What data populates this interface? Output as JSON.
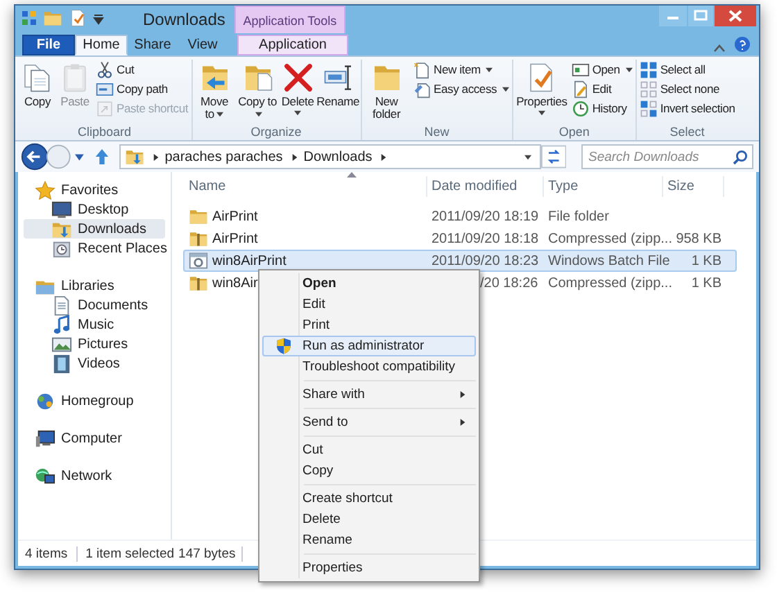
{
  "window": {
    "title": "Downloads",
    "contextual_group": "Application Tools"
  },
  "tabs": [
    {
      "label": "File",
      "kind": "file",
      "selected": false
    },
    {
      "label": "Home",
      "kind": "tab",
      "selected": true
    },
    {
      "label": "Share",
      "kind": "tab",
      "selected": false
    },
    {
      "label": "View",
      "kind": "tab",
      "selected": false
    },
    {
      "label": "Application",
      "kind": "contextual",
      "selected": false
    }
  ],
  "ribbon": [
    {
      "label": "Clipboard",
      "buttons": [
        {
          "label": "Copy",
          "kind": "large",
          "disabled": false,
          "dropdown": false
        },
        {
          "label": "Paste",
          "kind": "large",
          "disabled": true,
          "dropdown": false
        },
        {
          "label": "Cut",
          "kind": "small",
          "disabled": false,
          "dropdown": false
        },
        {
          "label": "Copy path",
          "kind": "small",
          "disabled": false,
          "dropdown": false
        },
        {
          "label": "Paste shortcut",
          "kind": "small",
          "disabled": true,
          "dropdown": false
        }
      ]
    },
    {
      "label": "Organize",
      "buttons": [
        {
          "label": "Move to",
          "kind": "large",
          "disabled": false,
          "dropdown": true
        },
        {
          "label": "Copy to",
          "kind": "large",
          "disabled": false,
          "dropdown": true
        },
        {
          "label": "Delete",
          "kind": "large",
          "disabled": false,
          "dropdown": true
        },
        {
          "label": "Rename",
          "kind": "large",
          "disabled": false,
          "dropdown": false
        }
      ]
    },
    {
      "label": "New",
      "buttons": [
        {
          "label": "New folder",
          "kind": "large",
          "disabled": false,
          "dropdown": false
        },
        {
          "label": "New item",
          "kind": "small",
          "disabled": false,
          "dropdown": true
        },
        {
          "label": "Easy access",
          "kind": "small",
          "disabled": false,
          "dropdown": true
        }
      ]
    },
    {
      "label": "Open",
      "buttons": [
        {
          "label": "Properties",
          "kind": "large",
          "disabled": false,
          "dropdown": true
        },
        {
          "label": "Open",
          "kind": "small",
          "disabled": false,
          "dropdown": true
        },
        {
          "label": "Edit",
          "kind": "small",
          "disabled": false,
          "dropdown": false
        },
        {
          "label": "History",
          "kind": "small",
          "disabled": false,
          "dropdown": false
        }
      ]
    },
    {
      "label": "Select",
      "buttons": [
        {
          "label": "Select all",
          "kind": "small",
          "disabled": false,
          "dropdown": false
        },
        {
          "label": "Select none",
          "kind": "small",
          "disabled": false,
          "dropdown": false
        },
        {
          "label": "Invert selection",
          "kind": "small",
          "disabled": false,
          "dropdown": false
        }
      ]
    }
  ],
  "address_bar": {
    "path": [
      "paraches paraches",
      "Downloads"
    ],
    "search_placeholder": "Search Downloads"
  },
  "navigation": [
    {
      "label": "Favorites",
      "selected": false,
      "children": [
        {
          "label": "Desktop",
          "selected": false
        },
        {
          "label": "Downloads",
          "selected": true
        },
        {
          "label": "Recent Places",
          "selected": false
        }
      ]
    },
    {
      "label": "Libraries",
      "selected": false,
      "children": [
        {
          "label": "Documents",
          "selected": false
        },
        {
          "label": "Music",
          "selected": false
        },
        {
          "label": "Pictures",
          "selected": false
        },
        {
          "label": "Videos",
          "selected": false
        }
      ]
    },
    {
      "label": "Homegroup",
      "selected": false
    },
    {
      "label": "Computer",
      "selected": false
    },
    {
      "label": "Network",
      "selected": false
    }
  ],
  "file_list": {
    "columns": [
      "Name",
      "Date modified",
      "Type",
      "Size"
    ],
    "rows": [
      {
        "kind": "folder",
        "name": "AirPrint",
        "date": "2011/09/20 18:19",
        "type": "File folder",
        "selected": false
      },
      {
        "kind": "zip",
        "name": "AirPrint",
        "date": "2011/09/20 18:18",
        "type": "Compressed (zipp...",
        "size": "958 KB",
        "selected": false
      },
      {
        "kind": "batch",
        "name": "win8AirPrint",
        "date": "2011/09/20 18:23",
        "type": "Windows Batch File",
        "size": "1 KB",
        "selected": true
      },
      {
        "kind": "zip",
        "name": "win8Air",
        "date": "/20 18:26",
        "type": "Compressed (zipp...",
        "size": "1 KB",
        "selected": false
      }
    ]
  },
  "context_menu": [
    [
      {
        "label": "Open",
        "default": true,
        "selected": false,
        "submenu": false,
        "shield": false
      },
      {
        "label": "Edit",
        "default": false,
        "selected": false,
        "submenu": false,
        "shield": false
      },
      {
        "label": "Print",
        "default": false,
        "selected": false,
        "submenu": false,
        "shield": false
      },
      {
        "label": "Run as administrator",
        "default": false,
        "selected": true,
        "submenu": false,
        "shield": true
      },
      {
        "label": "Troubleshoot compatibility",
        "default": false,
        "selected": false,
        "submenu": false,
        "shield": false
      }
    ],
    [
      {
        "label": "Share with",
        "default": false,
        "selected": false,
        "submenu": true,
        "shield": false
      }
    ],
    [
      {
        "label": "Send to",
        "default": false,
        "selected": false,
        "submenu": true,
        "shield": false
      }
    ],
    [
      {
        "label": "Cut",
        "default": false,
        "selected": false,
        "submenu": false,
        "shield": false
      },
      {
        "label": "Copy",
        "default": false,
        "selected": false,
        "submenu": false,
        "shield": false
      }
    ],
    [
      {
        "label": "Create shortcut",
        "default": false,
        "selected": false,
        "submenu": false,
        "shield": false
      },
      {
        "label": "Delete",
        "default": false,
        "selected": false,
        "submenu": false,
        "shield": false
      },
      {
        "label": "Rename",
        "default": false,
        "selected": false,
        "submenu": false,
        "shield": false
      }
    ],
    [
      {
        "label": "Properties",
        "default": false,
        "selected": false,
        "submenu": false,
        "shield": false
      }
    ]
  ],
  "status_bar": [
    "4 items",
    "1 item selected",
    "147 bytes"
  ]
}
